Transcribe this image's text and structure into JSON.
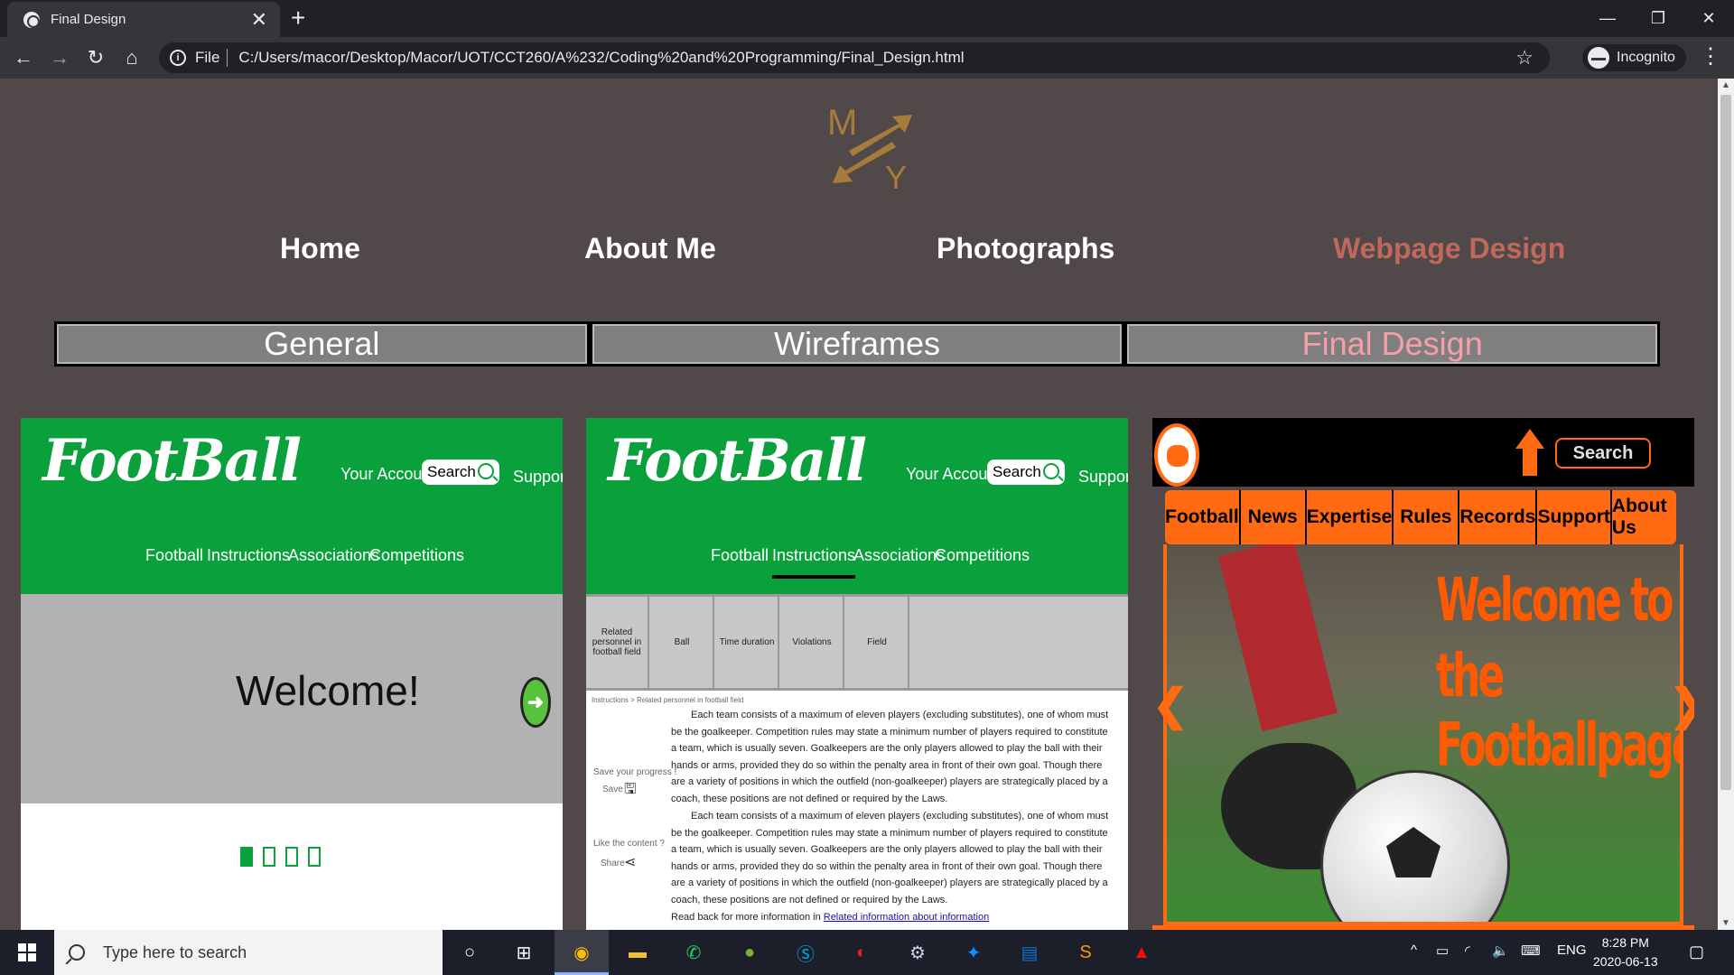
{
  "browser": {
    "tab_title": "Final Design",
    "close_glyph": "✕",
    "new_tab_glyph": "+",
    "file_label": "File",
    "url": "C:/Users/macor/Desktop/Macor/UOT/CCT260/A%232/Coding%20and%20Programming/Final_Design.html",
    "profile_label": "Incognito",
    "window_controls": [
      "—",
      "❐",
      "✕"
    ]
  },
  "site": {
    "logo_letters": [
      "M",
      "Y"
    ],
    "main_nav": [
      "Home",
      "About Me",
      "Photographs",
      "Webpage Design"
    ],
    "active_main": "Webpage Design",
    "sub_nav": [
      "General",
      "Wireframes",
      "Final Design"
    ],
    "active_sub": "Final Design",
    "accent_color": "#c0685b",
    "background_color": "#51484a"
  },
  "panel1": {
    "logo": "FootBall",
    "account": "Your Account",
    "search": "Search",
    "support": "Support",
    "nav": [
      "Football",
      "Instructions",
      "Associations",
      "Competitions"
    ],
    "welcome": "Welcome!",
    "arrow_glyph": "➜",
    "carousel_active": 1,
    "carousel_count": 4
  },
  "panel2": {
    "logo": "FootBall",
    "account": "Your Account",
    "search": "Search",
    "support": "Support",
    "nav": [
      "Football",
      "Instructions",
      "Associations",
      "Competitions"
    ],
    "active_nav": "Instructions",
    "tabs": [
      "Related personnel in football field",
      "Ball",
      "Time duration",
      "Violations",
      "Field"
    ],
    "breadcrumb": "Instructions > Related personnel in football field",
    "paragraph": "Each team consists of a maximum of eleven players (excluding substitutes), one of whom must be the goalkeeper. Competition rules may state a minimum number of players required to constitute a team, which is usually seven. Goalkeepers are the only players allowed to play the ball with their hands or arms, provided they do so within the penalty area in front of their own goal. Though there are a variety of positions in which the outfield (non-goalkeeper) players are strategically placed by a coach, these positions are not defined or required by the Laws.",
    "save_prompt": "Save your progress !",
    "save_label": "Save",
    "like_prompt": "Like the content ?",
    "share_label": "Share",
    "read_back": "Read back for more information in",
    "read_back_link": "Related information about information"
  },
  "panel3": {
    "search": "Search",
    "nav": [
      "Football",
      "News",
      "Expertise",
      "Rules",
      "Records",
      "Support",
      "About Us"
    ],
    "title_line1": "Welcome to",
    "title_line2": "the Footballpage!",
    "chevron_left": "❮",
    "chevron_right": "❯",
    "brand_color": "#ff6a13"
  },
  "taskbar": {
    "search_placeholder": "Type here to search",
    "language": "ENG",
    "time": "8:28 PM",
    "date": "2020-06-13",
    "pinned_apps": [
      "cortana-icon",
      "task-view-icon",
      "chrome-icon",
      "file-explorer-icon",
      "whatsapp-icon",
      "wechat-icon",
      "skype-icon",
      "garena-icon",
      "steam-icon",
      "battle-net-icon",
      "outlook-icon",
      "sublime-icon",
      "acrobat-icon"
    ]
  }
}
